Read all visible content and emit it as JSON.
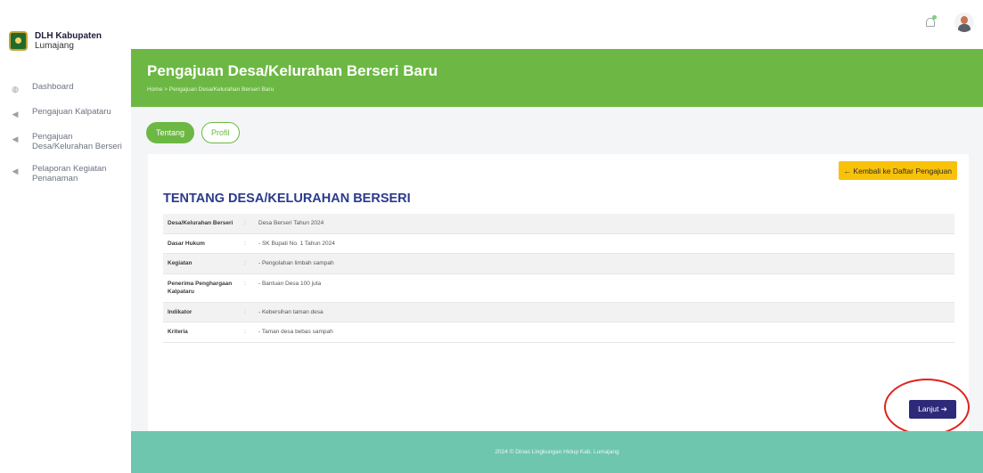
{
  "brand": {
    "name": "DLH Kabupaten",
    "sub": "Lumajang"
  },
  "sidebar": {
    "items": [
      {
        "label": "Dashboard",
        "icon": "dashboard-icon"
      },
      {
        "label": "Pengajuan Kalpataru",
        "icon": "send-icon"
      },
      {
        "label": "Pengajuan Desa/Kelurahan Berseri",
        "icon": "send-icon"
      },
      {
        "label": "Pelaporan Kegiatan Penanaman",
        "icon": "send-icon"
      }
    ]
  },
  "header": {
    "title": "Pengajuan Desa/Kelurahan Berseri Baru",
    "breadcrumb": "Home  >  Pengajuan Desa/Kelurahan Berseri Baru"
  },
  "tabs": [
    {
      "label": "Tentang",
      "active": true
    },
    {
      "label": "Profil",
      "active": false
    }
  ],
  "content": {
    "back_button": "← Kembali ke Daftar Pengajuan",
    "section_title": "TENTANG DESA/KELURAHAN BERSERI",
    "rows": [
      {
        "label": "Desa/Kelurahan Berseri",
        "sep": ":",
        "value": "Desa Berseri Tahun 2024"
      },
      {
        "label": "Dasar Hukum",
        "sep": ":",
        "value": "- SK Bupati No. 1 Tahun 2024"
      },
      {
        "label": "Kegiatan",
        "sep": ":",
        "value": "- Pengolahan limbah sampah"
      },
      {
        "label": "Penerima Penghargaan Kalpataru",
        "sep": ":",
        "value": "- Bantuan Desa 100 juta"
      },
      {
        "label": "Indikator",
        "sep": ":",
        "value": "- Kebersihan taman desa"
      },
      {
        "label": "Kriteria",
        "sep": ":",
        "value": "- Taman desa bebas sampah"
      }
    ],
    "next_button": "Lanjut ➔"
  },
  "footer": {
    "text": "2024 © Dinas Lingkungan Hidup Kab. Lumajang"
  },
  "colors": {
    "green": "#6db844",
    "navy": "#2d2a7a",
    "yellow": "#f8c20a",
    "teal": "#6ec6ae",
    "highlight": "#e0221d"
  }
}
